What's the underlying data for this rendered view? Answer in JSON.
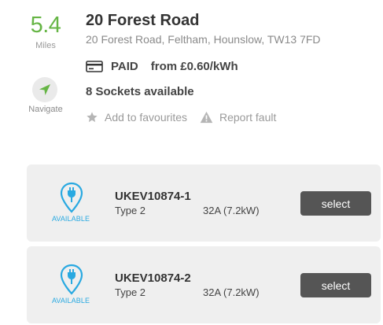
{
  "distance": {
    "value": "5.4",
    "unit": "Miles"
  },
  "navigate": {
    "label": "Navigate"
  },
  "location": {
    "title": "20 Forest Road",
    "address": "20 Forest Road, Feltham, Hounslow, TW13 7FD"
  },
  "pricing": {
    "status": "PAID",
    "rate": "from £0.60/kWh",
    "icon": "credit-card-icon"
  },
  "availability": {
    "sockets_text": "8 Sockets available"
  },
  "actions": {
    "favourites_label": "Add to favourites",
    "fault_label": "Report fault"
  },
  "connectors": [
    {
      "id": "UKEV10874-1",
      "type": "Type 2",
      "power": "32A (7.2kW)",
      "status": "AVAILABLE",
      "button_label": "select"
    },
    {
      "id": "UKEV10874-2",
      "type": "Type 2",
      "power": "32A (7.2kW)",
      "status": "AVAILABLE",
      "button_label": "select"
    }
  ],
  "colors": {
    "distance": "#66b545",
    "available": "#29a9e1",
    "button": "#555555",
    "card_bg": "#efefef"
  }
}
